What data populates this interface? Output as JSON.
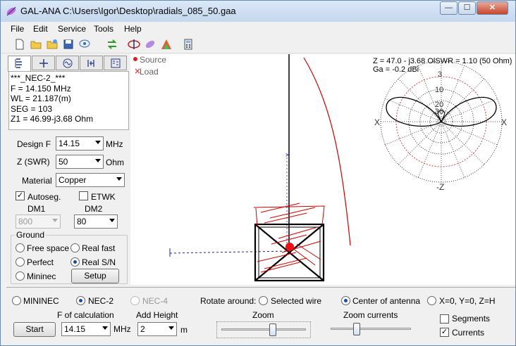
{
  "window": {
    "title": "GAL-ANA C:\\Users\\Igor\\Desktop\\radials_085_50.gaa",
    "minimize": "—",
    "maximize": "☐",
    "close": "✕"
  },
  "menu": [
    "File",
    "Edit",
    "Service",
    "Tools",
    "Help"
  ],
  "toolbar_icons": [
    "new-file-icon",
    "open-folder-icon",
    "open-recent-icon",
    "save-icon",
    "pattern-icon",
    "reverse-icon",
    "antenna-icon",
    "shape-icon",
    "color-map-icon",
    "calculator-icon"
  ],
  "tabs": [
    "geometry-tab",
    "cross-tab",
    "source-tab",
    "sweep-tab",
    "impedance-tab"
  ],
  "info": {
    "line1": "***_NEC-2_***",
    "line2": "F = 14.150 MHz",
    "line3": "WL = 21.187(m)",
    "line4": "SEG = 103",
    "line5": "Z1 = 46.99-j3.68 Ohm"
  },
  "design": {
    "design_f_label": "Design F",
    "design_f_value": "14.15",
    "mhz_label": "MHz",
    "z_label": "Z (SWR)",
    "z_value": "50",
    "ohm_label": "Ohm",
    "material_label": "Material",
    "material_value": "Copper",
    "autoseg_label": "Autoseg.",
    "etwk_label": "ETWK",
    "dm1_label": "DM1",
    "dm1_value": "800",
    "dm2_label": "DM2",
    "dm2_value": "80"
  },
  "ground": {
    "title": "Ground",
    "free_space": "Free space",
    "real_fast": "Real fast",
    "perfect": "Perfect",
    "real_sn": "Real S/N",
    "mininec": "Mininec",
    "setup": "Setup"
  },
  "canvas": {
    "source_label": "Source",
    "load_label": "Load",
    "z_readout": "Z = 47.0 - j3.68 OlSWR = 1.10 (50 Ohm)",
    "ga_readout": "Ga = -0.2 dBi",
    "polar_rings": [
      "3",
      "10",
      "20",
      "30"
    ],
    "axis_left": "X",
    "axis_right": "X",
    "axis_bottom": "-Z"
  },
  "bottom": {
    "mininec": "MININEC",
    "nec2": "NEC-2",
    "nec4": "NEC-4",
    "rotate_label": "Rotate around:",
    "selected_wire": "Selected wire",
    "center_antenna": "Center of antenna",
    "origin": "X=0, Y=0, Z=H",
    "f_calc_label": "F of calculation",
    "f_calc_value": "14.15",
    "mhz": "MHz",
    "add_height_label": "Add Height",
    "add_height_value": "2",
    "m": "m",
    "start": "Start",
    "zoom_label": "Zoom",
    "zoom_currents_label": "Zoom currents",
    "segments": "Segments",
    "currents": "Currents"
  }
}
